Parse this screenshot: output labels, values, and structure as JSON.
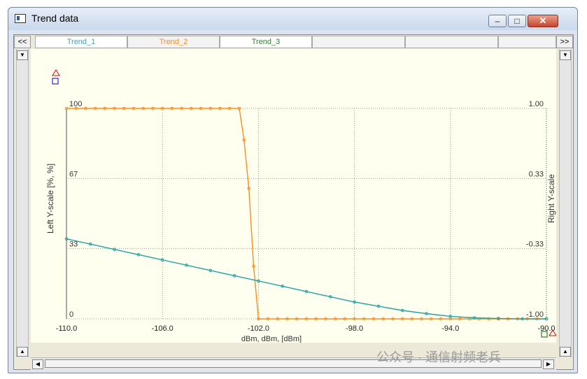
{
  "window": {
    "title": "Trend data"
  },
  "title_buttons": {
    "minimize": "–",
    "maximize": "□",
    "close": "✕"
  },
  "tabs": {
    "prev": "<<",
    "next": ">>",
    "items": [
      {
        "label": "Trend_1",
        "color": "#3aa8b8"
      },
      {
        "label": "Trend_2",
        "color": "#ff8c1a"
      },
      {
        "label": "Trend_3",
        "color": "#2f7d2f"
      },
      {
        "label": ""
      },
      {
        "label": ""
      },
      {
        "label": ""
      }
    ]
  },
  "scroll": {
    "up": "▲",
    "down": "▼",
    "left": "◀",
    "right": "▶"
  },
  "watermark": "公众号 · 通信射频老兵",
  "chart_data": {
    "type": "line",
    "xlabel": "dBm, dBm,   [dBm]",
    "ylabel_left": "Left Y-scale  [%, %]",
    "ylabel_right": "Right Y-scale",
    "xlim": [
      -110,
      -90
    ],
    "ylim_left": [
      0,
      100
    ],
    "ylim_right": [
      -1,
      1
    ],
    "x_ticks": [
      "-110.0",
      "-106.0",
      "-102.0",
      "-98.0",
      "-94.0",
      "-90.0"
    ],
    "y_ticks_left": [
      "0",
      "33",
      "67",
      "100"
    ],
    "y_ticks_right": [
      "-1.00",
      "-0.33",
      "0.33",
      "1.00"
    ],
    "grid": true,
    "series": [
      {
        "color": "#ff8c1a",
        "x": [
          -110,
          -109.6,
          -109.2,
          -108.8,
          -108.4,
          -108,
          -107.6,
          -107.2,
          -106.8,
          -106.4,
          -106,
          -105.6,
          -105.2,
          -104.8,
          -104.4,
          -104,
          -103.6,
          -103.2,
          -102.8,
          -102.6,
          -102.4,
          -102.2,
          -102,
          -101.6,
          -101.2,
          -100.8,
          -100.4,
          -100,
          -99.6,
          -99.2,
          -98.8,
          -98.4,
          -98,
          -97.6,
          -97.2,
          -96.8,
          -96.4,
          -96,
          -95.6,
          -95.2,
          -94.8,
          -94.4,
          -94,
          -93.6,
          -93.2,
          -92.8,
          -92.4,
          -92,
          -91.6,
          -91.2,
          -90.8,
          -90.4,
          -90
        ],
        "y": [
          100,
          100,
          100,
          100,
          100,
          100,
          100,
          100,
          100,
          100,
          100,
          100,
          100,
          100,
          100,
          100,
          100,
          100,
          100,
          85,
          62,
          25,
          0,
          0,
          0,
          0,
          0,
          0,
          0,
          0,
          0,
          0,
          0,
          0,
          0,
          0,
          0,
          0,
          0,
          0,
          0,
          0,
          0,
          0,
          0,
          0,
          0,
          0,
          0,
          0,
          0,
          0,
          0
        ]
      },
      {
        "color": "#21a3a3",
        "x": [
          -110,
          -109,
          -108,
          -107,
          -106,
          -105,
          -104,
          -103,
          -102,
          -101,
          -100,
          -99,
          -98,
          -97,
          -96,
          -95,
          -94,
          -93,
          -92,
          -91,
          -90
        ],
        "y": [
          38,
          35.5,
          33,
          30.5,
          28,
          25.5,
          23,
          20.5,
          18,
          15.5,
          13,
          10.5,
          8,
          6,
          4,
          2.5,
          1.2,
          0.5,
          0.2,
          0,
          0
        ]
      }
    ]
  }
}
